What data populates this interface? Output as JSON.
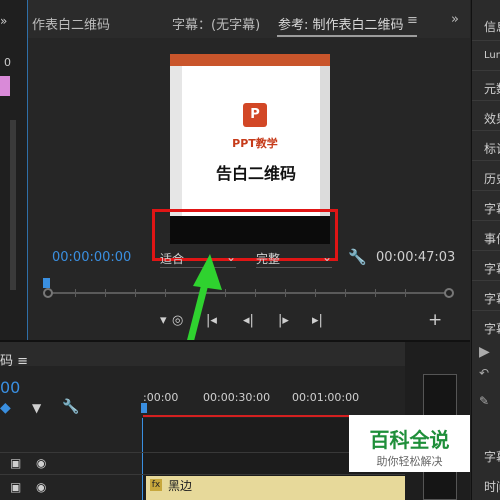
{
  "tabs": {
    "left_fragment": "作表白二维码",
    "subtitles": "字幕：(无字幕)",
    "reference": "参考: 制作表白二维码",
    "menu_glyph": "≡",
    "overflow_glyph": "»"
  },
  "left_strip": {
    "value": "0"
  },
  "video": {
    "app_label": "PPT教学",
    "logo_letter": "P",
    "title": "告白二维码"
  },
  "monitor": {
    "timecode_current": "00:00:00:00",
    "timecode_total": "00:00:47:03",
    "fit_label": "适合",
    "quality_label": "完整"
  },
  "right_panel": {
    "items": [
      "信息",
      "Lum",
      "元数",
      "效果",
      "标记",
      "历史",
      "字幕",
      "事件",
      "字幕",
      "字幕",
      "字幕",
      "字幕",
      "时间"
    ]
  },
  "timeline": {
    "sequence_name": "码",
    "menu_glyph": "≡",
    "timecode": "00",
    "ruler": [
      ":00:00",
      "00:00:30:00",
      "00:01:00:00"
    ],
    "clip_label": "黑边",
    "clip_fx": "fx"
  },
  "watermark": {
    "title": "百科全说",
    "subtitle": "助你轻松解决"
  },
  "colors": {
    "accent_blue": "#3a8fe0",
    "highlight_red": "#e01515",
    "arrow_green": "#2fd22f",
    "clip_yellow": "#e7d99a"
  }
}
